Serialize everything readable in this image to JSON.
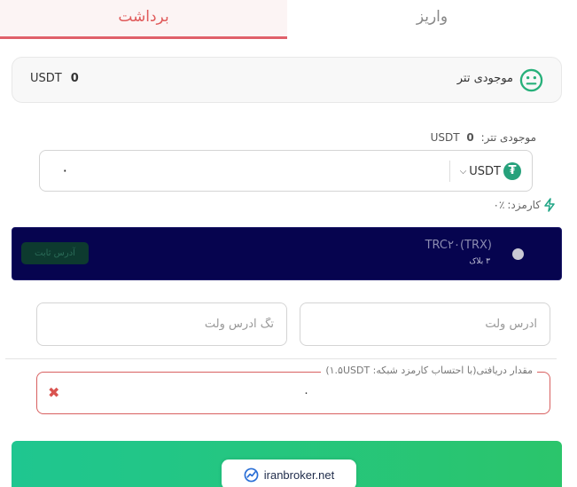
{
  "tabs": {
    "withdraw": "برداشت",
    "deposit": "واریز"
  },
  "balance_card": {
    "label": "موجودی تتر",
    "currency": "USDT",
    "value": "0"
  },
  "small_balance": {
    "label": "موجودی تتر:",
    "value": "0",
    "currency": "USDT"
  },
  "amount": {
    "value": "۰",
    "currency": "USDT",
    "currency_logo": "₮"
  },
  "fee": {
    "label": "کارمزد:",
    "value": "۰٪"
  },
  "network": {
    "name": "TRC۲۰(TRX)",
    "sub": "۳ بلاک",
    "fixed_address_label": "آدرس ثابت"
  },
  "wallet_address": {
    "placeholder": "آدرس ولت"
  },
  "wallet_tag": {
    "placeholder": "تگ آدرس ولت"
  },
  "received": {
    "label": "مقدار دریافتی(با احتساب کارمزد شبکه: ۱.۵USDT)",
    "value": "۰",
    "clear": "✖"
  },
  "watermark": {
    "text": "iranbroker.net"
  },
  "colors": {
    "accent_red": "#e0606a",
    "network_bg": "#06044f",
    "tether_green": "#26a17b",
    "submit_green": "#2bc56b"
  }
}
